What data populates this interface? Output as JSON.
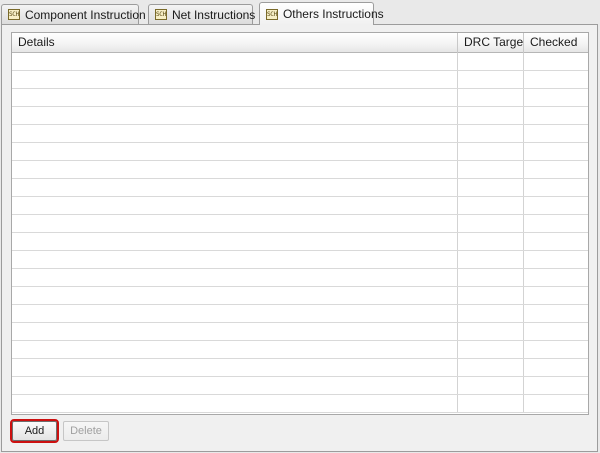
{
  "tabs": [
    {
      "icon": "sch-icon",
      "icon_text": "SCH",
      "label": "Component Instruction",
      "active": false
    },
    {
      "icon": "sch-icon",
      "icon_text": "SCH",
      "label": "Net Instructions",
      "active": false
    },
    {
      "icon": "sch-icon",
      "icon_text": "SCH",
      "label": "Others Instructions",
      "active": true
    }
  ],
  "table": {
    "columns": [
      "Details",
      "DRC Target",
      "Checked"
    ],
    "rows": []
  },
  "buttons": {
    "add_label": "Add",
    "delete_label": "Delete",
    "delete_enabled": false
  },
  "colors": {
    "highlight": "#cc1010"
  }
}
